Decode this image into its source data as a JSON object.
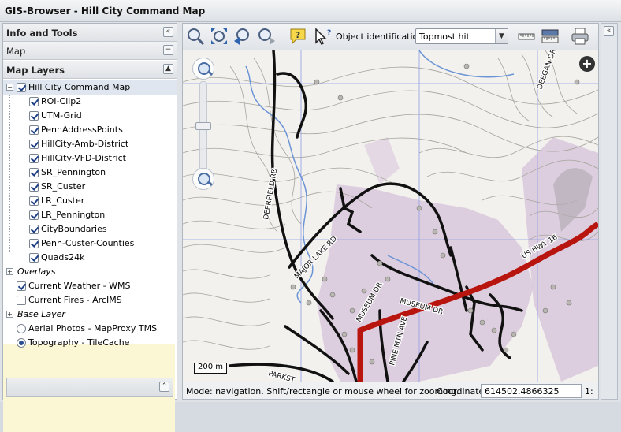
{
  "window": {
    "title": "GIS-Browser - Hill City Command Map"
  },
  "left_panel": {
    "info_tools_title": "Info and Tools",
    "map_section_title": "Map",
    "map_layers_title": "Map Layers",
    "collapse_icon": "double-chevron-left",
    "tree": {
      "root": {
        "label": "Hill City Command Map",
        "checked": true
      },
      "layers": [
        {
          "label": "ROI-Clip2",
          "checked": true
        },
        {
          "label": "UTM-Grid",
          "checked": true
        },
        {
          "label": "PennAddressPoints",
          "checked": true
        },
        {
          "label": "HillCity-Amb-District",
          "checked": true
        },
        {
          "label": "HillCity-VFD-District",
          "checked": true
        },
        {
          "label": "SR_Pennington",
          "checked": true
        },
        {
          "label": "SR_Custer",
          "checked": true
        },
        {
          "label": "LR_Custer",
          "checked": true
        },
        {
          "label": "LR_Pennington",
          "checked": true
        },
        {
          "label": "CityBoundaries",
          "checked": true
        },
        {
          "label": "Penn-Custer-Counties",
          "checked": true
        },
        {
          "label": "Quads24k",
          "checked": true
        }
      ],
      "overlays_label": "Overlays",
      "overlays": [
        {
          "label": "Current Weather - WMS",
          "checked": true
        },
        {
          "label": "Current Fires - ArcIMS",
          "checked": false
        }
      ],
      "base_layer_label": "Base Layer",
      "base_layers": [
        {
          "label": "Aerial Photos - MapProxy TMS",
          "selected": false
        },
        {
          "label": "Topography - TileCache",
          "selected": true
        }
      ]
    }
  },
  "toolbar": {
    "object_identification_label": "Object identification:",
    "object_identification_value": "Topmost hit",
    "icons": [
      "zoom-in-icon",
      "zoom-extent-icon",
      "zoom-previous-icon",
      "zoom-next-icon",
      "help-icon",
      "identify-icon",
      "measure-distance-icon",
      "measure-area-icon",
      "print-icon"
    ]
  },
  "map": {
    "scale_bar_label": "200 m",
    "road_labels": [
      "DEERFIELD RD",
      "MAJOR LAKE RD",
      "MUSEUM DR",
      "MUSEUM DR",
      "US HWY 16",
      "PINE MTN AVE",
      "DEEGAN DR",
      "PARKST"
    ],
    "colors": {
      "topo_bg": "#f2f1ed",
      "contour": "#9a9a92",
      "district": "#d9c8dc",
      "highway": "#b8150f",
      "road": "#111111",
      "water": "#6b94d6",
      "grid": "#8e9de6"
    }
  },
  "statusbar": {
    "mode_text": "Mode: navigation. Shift/rectangle or mouse wheel for zooming.",
    "coordinate_label": "Coordinate:",
    "coordinate_value": "614502,4866325",
    "scale_prefix": "1:"
  }
}
